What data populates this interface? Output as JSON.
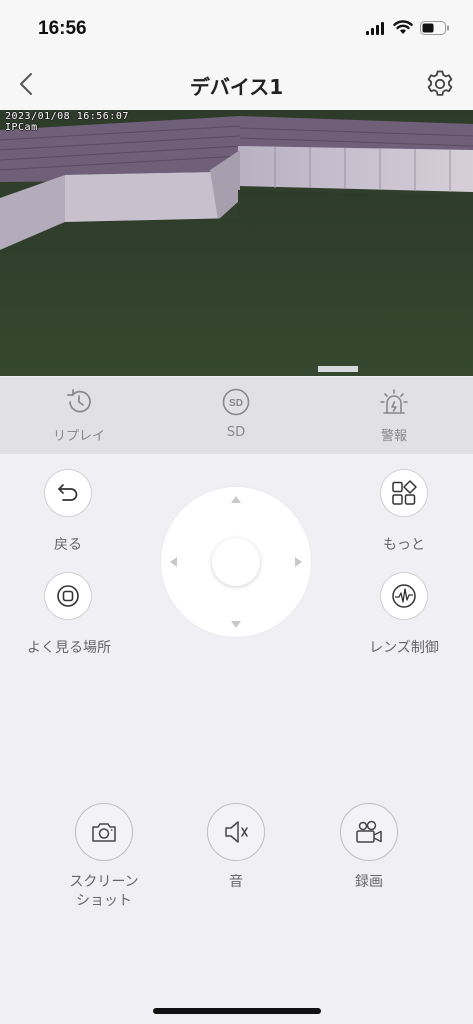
{
  "status": {
    "time": "16:56"
  },
  "nav": {
    "title": "デバイス1"
  },
  "video": {
    "timestamp": "2023/01/08 16:56:07",
    "camera_label": "IPCam"
  },
  "toolbar": {
    "replay": "リプレイ",
    "sd": "SD",
    "alarm": "警報"
  },
  "ptz": {
    "back": "戻る",
    "favorites": "よく見る場所",
    "more": "もっと",
    "lens": "レンズ制御"
  },
  "actions": {
    "screenshot_line1": "スクリーン",
    "screenshot_line2": "ショット",
    "sound": "音",
    "record": "録画"
  },
  "icons": {
    "status": [
      "signal-icon",
      "wifi-icon",
      "battery-icon"
    ],
    "nav": [
      "back-arrow-icon",
      "gear-icon"
    ],
    "toolbar": [
      "history-icon",
      "sd-card-icon",
      "alarm-light-icon"
    ],
    "ptz": [
      "undo-icon",
      "grid-diamond-icon",
      "favorite-location-icon",
      "lens-waveform-icon"
    ],
    "actions": [
      "camera-icon",
      "speaker-muted-icon",
      "video-camera-icon"
    ]
  }
}
